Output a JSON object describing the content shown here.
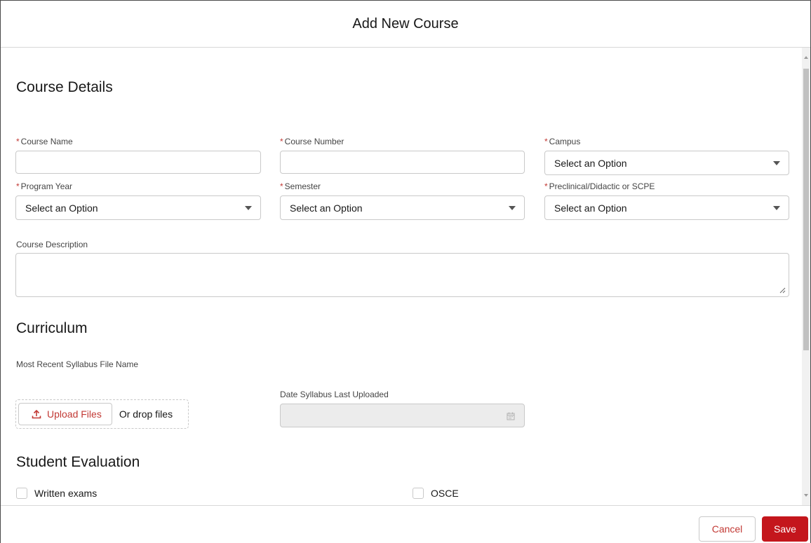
{
  "modal": {
    "title": "Add New Course"
  },
  "course_details": {
    "title": "Course Details",
    "course_name": {
      "label": "Course Name",
      "required_mark": "*",
      "value": ""
    },
    "course_number": {
      "label": "Course Number",
      "required_mark": "*",
      "value": ""
    },
    "campus": {
      "label": "Campus",
      "required_mark": "*",
      "value": "Select an Option"
    },
    "program_year": {
      "label": "Program Year",
      "required_mark": "*",
      "value": "Select an Option"
    },
    "semester": {
      "label": "Semester",
      "required_mark": "*",
      "value": "Select an Option"
    },
    "preclinical": {
      "label": "Preclinical/Didactic or SCPE",
      "required_mark": "*",
      "value": "Select an Option"
    },
    "course_description": {
      "label": "Course Description",
      "value": ""
    }
  },
  "curriculum": {
    "title": "Curriculum",
    "syllabus_file_label": "Most Recent Syllabus File Name",
    "upload_button": "Upload Files",
    "drop_text": "Or drop files",
    "date_label": "Date Syllabus Last Uploaded",
    "date_value": ""
  },
  "student_evaluation": {
    "title": "Student Evaluation",
    "options": [
      {
        "label": "Written exams",
        "checked": false
      },
      {
        "label": "OSCE",
        "checked": false
      }
    ]
  },
  "footer": {
    "cancel_label": "Cancel",
    "save_label": "Save"
  },
  "colors": {
    "accent": "#c4161c",
    "required": "#c23934",
    "border": "#c9c9c9",
    "disabled_bg": "#ececec"
  },
  "icons": {
    "upload": "upload-icon",
    "calendar": "calendar-icon",
    "dropdown": "chevron-down-icon"
  }
}
